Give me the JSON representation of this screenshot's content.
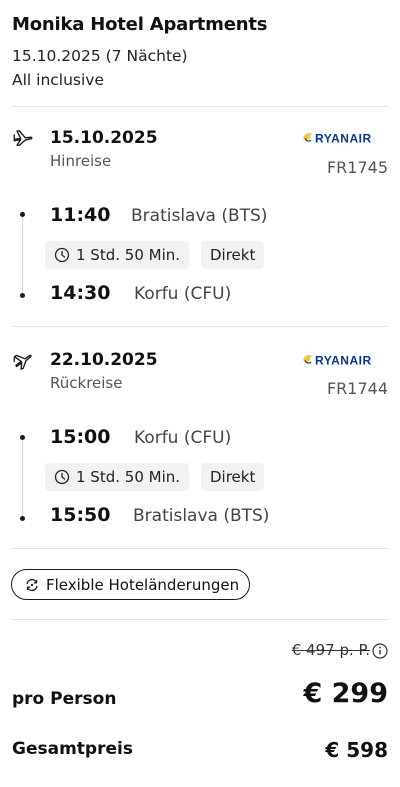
{
  "hotel": {
    "name": "Monika Hotel Apartments",
    "dates": "15.10.2025 (7 Nächte)",
    "board": "All inclusive"
  },
  "outbound": {
    "date": "15.10.2025",
    "direction": "Hinreise",
    "airline_logo": "RYANAIR",
    "flight_number": "FR1745",
    "departure_time": "11:40",
    "departure_airport": "Bratislava (BTS)",
    "duration": "1 Std. 50 Min.",
    "stops": "Direkt",
    "arrival_time": "14:30",
    "arrival_airport": "Korfu (CFU)",
    "icon": "plane-departure-icon"
  },
  "return": {
    "date": "22.10.2025",
    "direction": "Rückreise",
    "airline_logo": "RYANAIR",
    "flight_number": "FR1744",
    "departure_time": "15:00",
    "departure_airport": "Korfu (CFU)",
    "duration": "1 Std. 50 Min.",
    "stops": "Direkt",
    "arrival_time": "15:50",
    "arrival_airport": "Bratislava (BTS)",
    "icon": "plane-arrival-icon"
  },
  "flex_badge": {
    "label": "Flexible Hoteländerungen"
  },
  "pricing": {
    "old_price": "€ 497 p. P.",
    "per_person_label": "pro Person",
    "per_person_price": "€ 299",
    "total_label": "Gesamtpreis",
    "total_price": "€ 598"
  },
  "colors": {
    "ryanair_blue": "#073590",
    "ryanair_yellow": "#f1c933",
    "text_primary": "#111111",
    "text_secondary": "#555555",
    "chip_bg": "#f2f2f2",
    "divider": "#e4e4e4"
  }
}
